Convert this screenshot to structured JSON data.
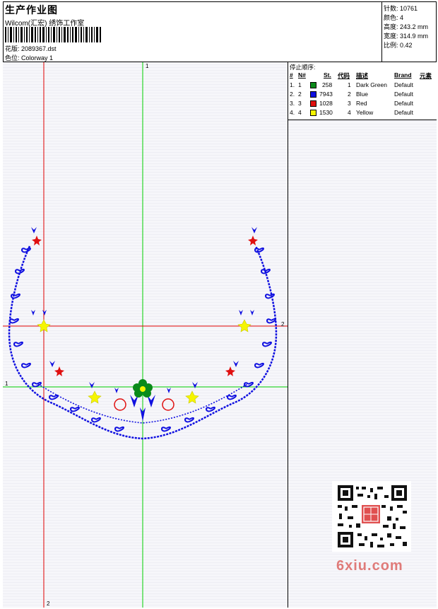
{
  "header": {
    "title": "生产作业图",
    "subtitle": "Wilcom(汇宏) 绣饰工作室",
    "design_label": "花版: 2089367.dst",
    "colorway_label": "色位: Colorway 1"
  },
  "stats": [
    {
      "label": "针数:",
      "value": "10761"
    },
    {
      "label": "颜色:",
      "value": "4"
    },
    {
      "label": "高度:",
      "value": "243.2 mm"
    },
    {
      "label": "宽度:",
      "value": "314.9 mm"
    },
    {
      "label": "比例:",
      "value": "0.42"
    }
  ],
  "stop_sequence": {
    "caption": "停止顺序:",
    "headers": {
      "num": "#",
      "n": "N#",
      "st": "St.",
      "code": "代码",
      "desc": "描述",
      "brand": "Brand",
      "elem": "元素"
    },
    "rows": [
      {
        "num": "1.",
        "n": "1",
        "color": "#0a8a1a",
        "st": "258",
        "code": "1",
        "desc": "Dark Green",
        "brand": "Default"
      },
      {
        "num": "2.",
        "n": "2",
        "color": "#1010e0",
        "st": "7943",
        "code": "2",
        "desc": "Blue",
        "brand": "Default"
      },
      {
        "num": "3.",
        "n": "3",
        "color": "#e01010",
        "st": "1028",
        "code": "3",
        "desc": "Red",
        "brand": "Default"
      },
      {
        "num": "4.",
        "n": "4",
        "color": "#f5f500",
        "st": "1530",
        "code": "4",
        "desc": "Yellow",
        "brand": "Default"
      }
    ]
  },
  "guides": {
    "v1": "1",
    "h1": "1",
    "v2": "2",
    "h2": "2"
  },
  "watermark": "6xiu.com",
  "colors": {
    "green": "#0a8a1a",
    "blue": "#1010e0",
    "red": "#e01010",
    "yellow": "#f5f500",
    "guide_red": "#e00000",
    "guide_green": "#00d000"
  }
}
